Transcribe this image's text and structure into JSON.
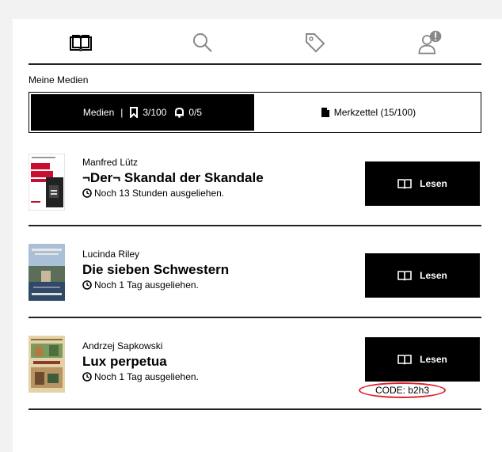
{
  "nav": {
    "items": [
      {
        "icon": "book-icon"
      },
      {
        "icon": "search-icon"
      },
      {
        "icon": "tag-icon"
      },
      {
        "icon": "account-alert-icon"
      }
    ]
  },
  "section_title": "Meine Medien",
  "tabs": {
    "media_label": "Medien",
    "media_separator": "|",
    "media_loans": "3/100",
    "media_reservations": "0/5",
    "notes_label": "Merkzettel (15/100)"
  },
  "items": [
    {
      "author": "Manfred Lütz",
      "title": "¬Der¬ Skandal der Skandale",
      "loan_status": "Noch 13 Stunden ausgeliehen.",
      "button_label": "Lesen"
    },
    {
      "author": "Lucinda Riley",
      "title": "Die sieben Schwestern",
      "loan_status": "Noch 1 Tag ausgeliehen.",
      "button_label": "Lesen"
    },
    {
      "author": "Andrzej Sapkowski",
      "title": "Lux perpetua",
      "loan_status": "Noch 1 Tag ausgeliehen.",
      "button_label": "Lesen"
    }
  ],
  "code_label": "CODE: b2h3",
  "colors": {
    "accent": "#000000",
    "highlight": "#e0202a",
    "background": "#f2f2f2"
  }
}
